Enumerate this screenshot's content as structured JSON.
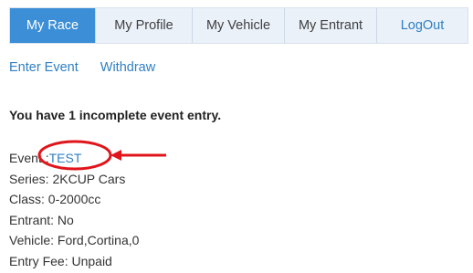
{
  "nav": {
    "tabs": [
      {
        "label": "My Race",
        "active": true
      },
      {
        "label": "My Profile",
        "active": false
      },
      {
        "label": "My Vehicle",
        "active": false
      },
      {
        "label": "My Entrant",
        "active": false
      },
      {
        "label": "LogOut",
        "active": false
      }
    ]
  },
  "actions": {
    "enter_event": "Enter Event",
    "withdraw": "Withdraw"
  },
  "notice": "You have 1 incomplete event entry.",
  "entry": {
    "event_label": "Event :",
    "event_value": "TEST",
    "series": "Series: 2KCUP Cars",
    "class": "Class: 0-2000cc",
    "entrant": "Entrant: No",
    "vehicle": "Vehicle: Ford,Cortina,0",
    "entry_fee": "Entry Fee: Unpaid"
  },
  "colors": {
    "active_tab": "#3c8fd6",
    "tab_bar": "#eaf1f9",
    "link": "#2f7fc3",
    "annotation": "#e0151b"
  }
}
